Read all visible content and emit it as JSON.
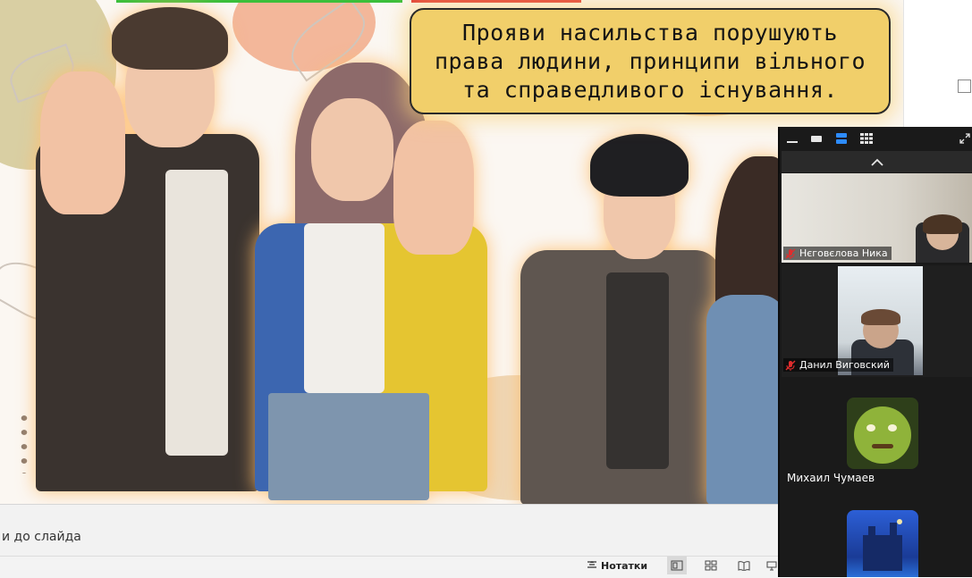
{
  "slide": {
    "title_lines": [
      "Прояви насильства порушують",
      "права людини, принципи  вільного",
      "та справедливого існування."
    ]
  },
  "editor": {
    "notes_hint": "и до слайда",
    "notes_button": "Нотатки",
    "view_buttons": [
      "normal-view-icon",
      "slide-sorter-icon",
      "reading-view-icon",
      "slideshow-icon"
    ]
  },
  "zoom": {
    "toolbar_icons": [
      "minimize-icon",
      "speaker-view-icon",
      "gallery-strip-icon",
      "gallery-grid-icon",
      "expand-icon"
    ],
    "scroll_up_label": "^",
    "participants": [
      {
        "name": "Нєговєлова Ника",
        "muted": true
      },
      {
        "name": "Данил Виговский",
        "muted": true
      },
      {
        "name": "Михаил Чумаев",
        "muted": false
      },
      {
        "name": "",
        "muted": false
      }
    ]
  },
  "colors": {
    "title_box": "#f1cf6a",
    "zoom_bg": "#1a1a1a",
    "accent_blue": "#2d8cff",
    "mute_red": "#e02d2d"
  }
}
